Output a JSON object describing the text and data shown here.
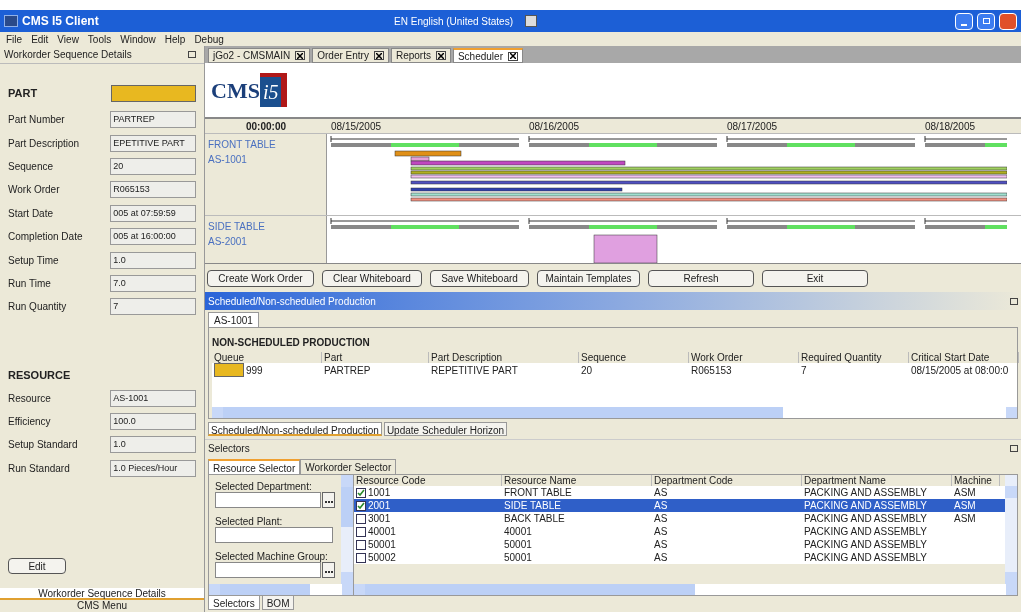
{
  "window": {
    "title": "CMS I5 Client",
    "language": "EN English (United States)"
  },
  "menu": [
    "File",
    "Edit",
    "View",
    "Tools",
    "Window",
    "Help",
    "Debug"
  ],
  "left_panel": {
    "title": "Workorder Sequence Details",
    "sections": [
      {
        "heading": "PART",
        "fields": [
          {
            "label": "Part Number",
            "value": "PARTREP"
          },
          {
            "label": "Part Description",
            "value": "EPETITIVE PART"
          },
          {
            "label": "Sequence",
            "value": "20"
          },
          {
            "label": "Work Order",
            "value": "R065153"
          },
          {
            "label": "Start Date",
            "value": "005 at 07:59:59"
          },
          {
            "label": "Completion Date",
            "value": "005 at 16:00:00"
          },
          {
            "label": "Setup Time",
            "value": "1.0"
          },
          {
            "label": "Run Time",
            "value": "7.0"
          },
          {
            "label": "Run Quantity",
            "value": "7"
          }
        ]
      },
      {
        "heading": "RESOURCE",
        "fields": [
          {
            "label": "Resource",
            "value": "AS-1001"
          },
          {
            "label": "Efficiency",
            "value": "100.0"
          },
          {
            "label": "Setup Standard",
            "value": "1.0"
          },
          {
            "label": "Run Standard",
            "value": "1.0 Pieces/Hour"
          }
        ]
      }
    ],
    "edit_button": "Edit",
    "bottom_tabs": [
      {
        "label": "Workorder Sequence Details",
        "selected": true
      },
      {
        "label": "CMS Menu",
        "selected": false
      }
    ]
  },
  "doc_tabs": [
    {
      "label": "jGo2 - CMSMAIN",
      "selected": false
    },
    {
      "label": "Order Entry",
      "selected": false
    },
    {
      "label": "Reports",
      "selected": false
    },
    {
      "label": "Scheduler",
      "selected": true
    }
  ],
  "logo": {
    "text": "CMS",
    "badge": "i5"
  },
  "gantt": {
    "time": "00:00:00",
    "dates": [
      "08/15/2005",
      "08/16/2005",
      "08/17/2005",
      "08/18/2005"
    ],
    "rows": [
      {
        "name": "FRONT TABLE",
        "code": "AS-1001"
      },
      {
        "name": "SIDE TABLE",
        "code": "AS-2001"
      }
    ]
  },
  "buttons": [
    "Create Work Order",
    "Clear Whiteboard",
    "Save Whiteboard",
    "Maintain Templates",
    "Refresh",
    "Exit"
  ],
  "production": {
    "title": "Scheduled/Non-scheduled Production",
    "tabs": [
      {
        "label": "AS-1001",
        "selected": true
      }
    ],
    "heading": "NON-SCHEDULED PRODUCTION",
    "columns": [
      "Queue",
      "Part",
      "Part Description",
      "Sequence",
      "Work Order",
      "Required Quantity",
      "Critical Start Date"
    ],
    "rows": [
      [
        "999",
        "PARTREP",
        "REPETITIVE PART",
        "20",
        "R065153",
        "7",
        "08/15/2005 at 08:00:0"
      ]
    ],
    "bottom_tabs": [
      {
        "label": "Scheduled/Non-scheduled Production",
        "selected": true
      },
      {
        "label": "Update Scheduler Horizon",
        "selected": false
      }
    ]
  },
  "selectors": {
    "title": "Selectors",
    "tabs": [
      {
        "label": "Resource Selector",
        "selected": true
      },
      {
        "label": "Workorder Selector",
        "selected": false
      }
    ],
    "filters": [
      "Selected Department:",
      "Selected Plant:",
      "Selected Machine Group:"
    ],
    "columns": [
      "Resource Code",
      "Resource Name",
      "Department Code",
      "Department Name",
      "Machine"
    ],
    "rows": [
      {
        "checked": true,
        "selected": false,
        "cells": [
          "1001",
          "FRONT TABLE",
          "AS",
          "PACKING AND ASSEMBLY",
          "ASM"
        ]
      },
      {
        "checked": true,
        "selected": true,
        "cells": [
          "2001",
          "SIDE TABLE",
          "AS",
          "PACKING AND ASSEMBLY",
          "ASM"
        ]
      },
      {
        "checked": false,
        "selected": false,
        "cells": [
          "3001",
          "BACK TABLE",
          "AS",
          "PACKING AND ASSEMBLY",
          "ASM"
        ]
      },
      {
        "checked": false,
        "selected": false,
        "cells": [
          "40001",
          "40001",
          "AS",
          "PACKING AND ASSEMBLY",
          ""
        ]
      },
      {
        "checked": false,
        "selected": false,
        "cells": [
          "50001",
          "50001",
          "AS",
          "PACKING AND ASSEMBLY",
          ""
        ]
      },
      {
        "checked": false,
        "selected": false,
        "cells": [
          "50002",
          "50001",
          "AS",
          "PACKING AND ASSEMBLY",
          ""
        ]
      }
    ],
    "bottom_tabs": [
      {
        "label": "Selectors",
        "selected": true
      },
      {
        "label": "BOM",
        "selected": false
      }
    ]
  }
}
